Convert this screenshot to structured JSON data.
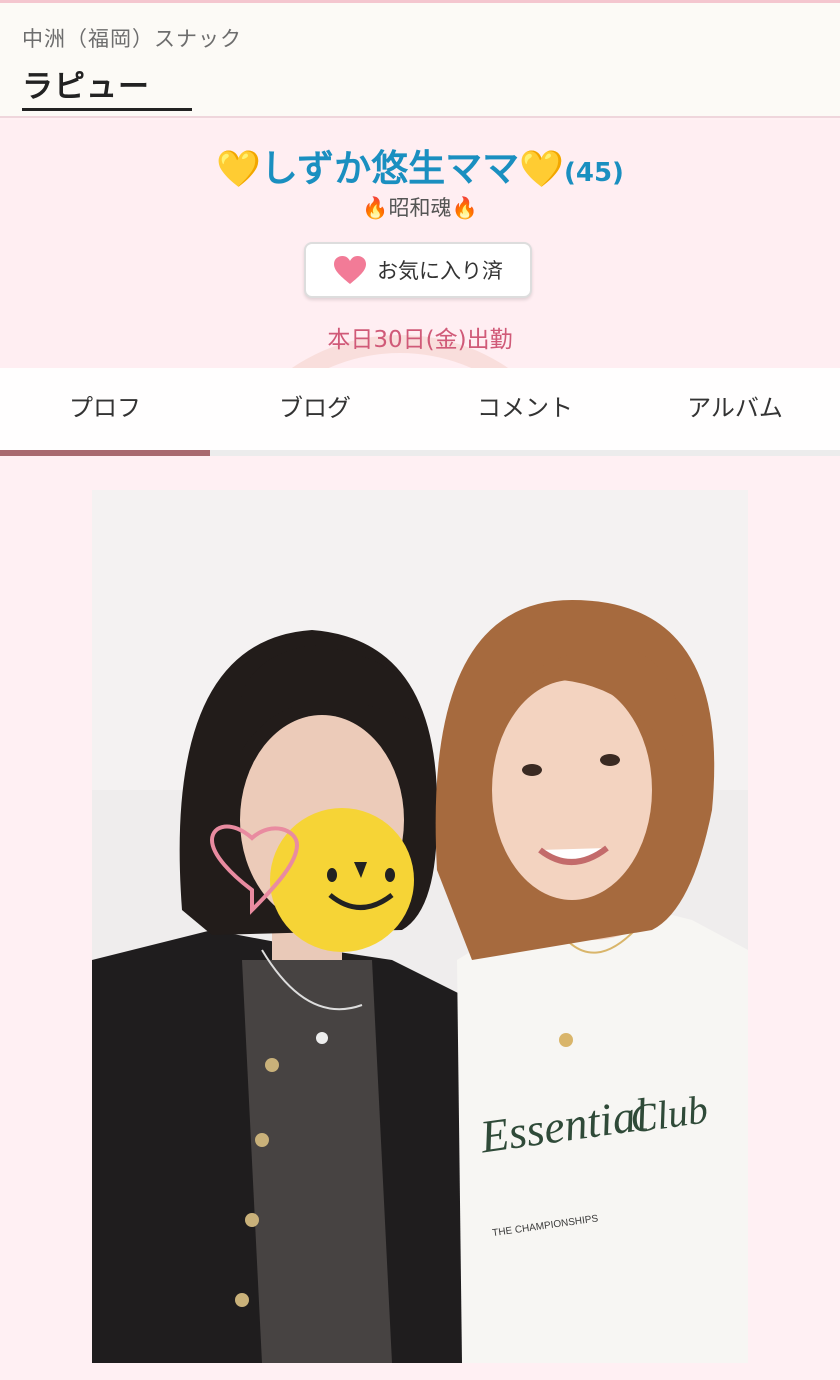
{
  "header": {
    "area": "中洲（福岡）スナック",
    "shop_name": "ラピュー"
  },
  "profile": {
    "name_heart_left": "💛",
    "name": "しずか悠生ママ",
    "name_heart_right": "💛",
    "age": "(45)",
    "catch_flame_left": "🔥",
    "catch": "昭和魂",
    "catch_flame_right": "🔥",
    "favorite_icon": "heart-icon",
    "favorite_label": "お気に入り済",
    "attendance": "本日30日(金)出勤"
  },
  "tabs": [
    {
      "label": "プロフ",
      "active": true
    },
    {
      "label": "ブログ",
      "active": false
    },
    {
      "label": "コメント",
      "active": false
    },
    {
      "label": "アルバム",
      "active": false
    }
  ],
  "photo": {
    "shirt_text_line1": "Essential",
    "shirt_text_line2": "Club",
    "shirt_text_line3": "THE CHAMPIONSHIPS"
  },
  "colors": {
    "name_blue": "#1a8fc0",
    "attendance_pink": "#d05a78",
    "tab_active": "#a96a6f",
    "background": "#fff0f3"
  }
}
